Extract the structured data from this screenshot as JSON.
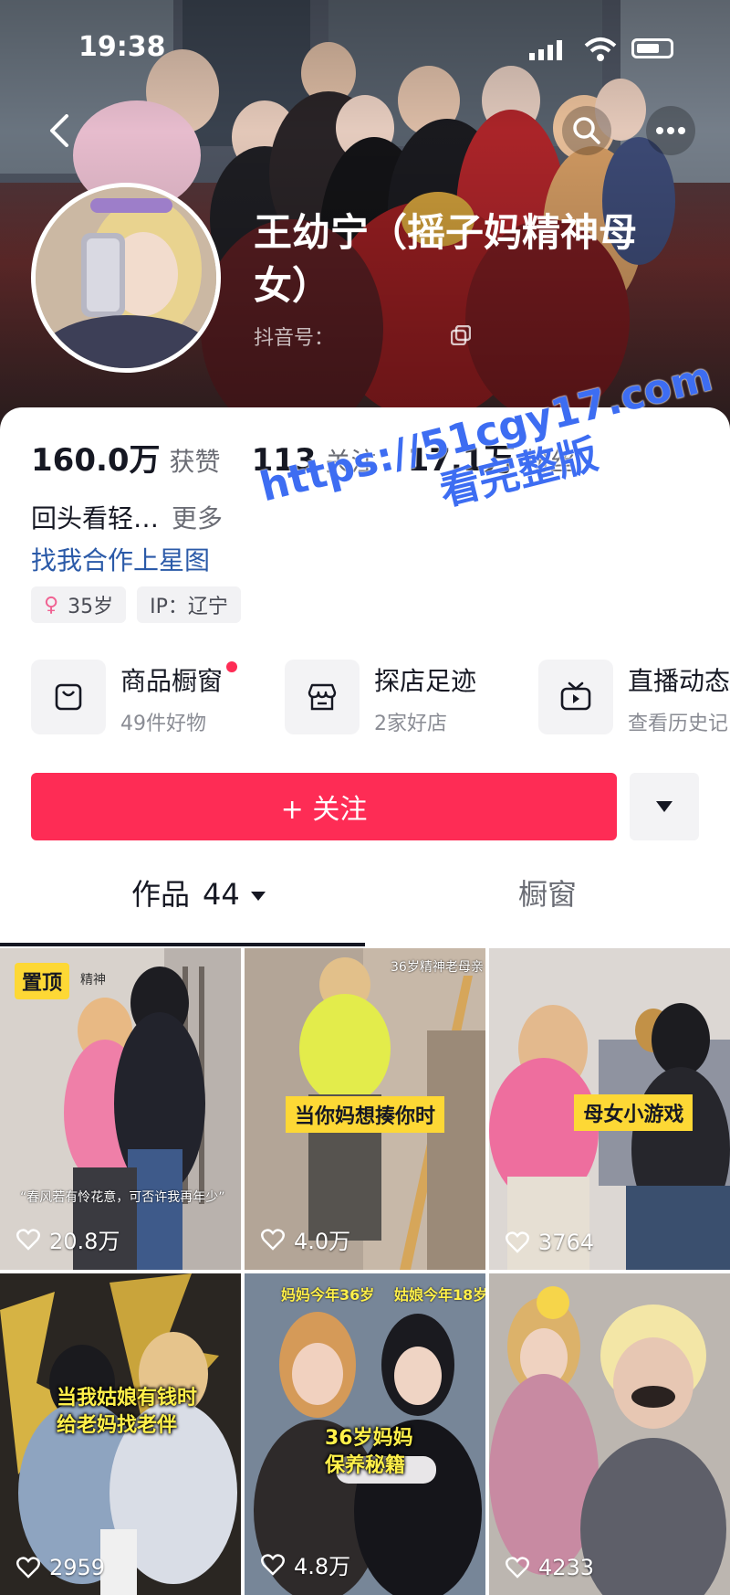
{
  "status_bar": {
    "time": "19:38"
  },
  "profile": {
    "name": "王幼宁（摇子妈精神母女）",
    "douyin_id_label": "抖音号：",
    "stats": [
      {
        "value": "160.0万",
        "label": "获赞"
      },
      {
        "value": "113",
        "label": "关注"
      },
      {
        "value": "17.1万",
        "label": "粉丝"
      }
    ],
    "bio": "回头看轻…",
    "bio_more": "更多",
    "cooperation_link": "找我合作上星图",
    "tags": {
      "age": "35岁",
      "ip": "IP：辽宁"
    }
  },
  "services": [
    {
      "title": "商品橱窗",
      "subtitle": "49件好物",
      "icon": "bag-icon"
    },
    {
      "title": "探店足迹",
      "subtitle": "2家好店",
      "icon": "store-icon"
    },
    {
      "title": "直播动态",
      "subtitle": "查看历史记",
      "icon": "tv-icon"
    }
  ],
  "actions": {
    "follow": "+ 关注"
  },
  "tabs": {
    "works_label": "作品",
    "works_count": "44",
    "shop_label": "橱窗"
  },
  "videos": [
    {
      "likes": "20.8万",
      "pin": "置顶",
      "subtitle": "“春风若有怜花意，可否许我再年少”",
      "tag": "精神"
    },
    {
      "likes": "4.0万",
      "caption": "当你妈想揍你时",
      "top_text": "36岁精神老母亲"
    },
    {
      "likes": "3764",
      "caption": "母女小游戏"
    },
    {
      "likes": "2959",
      "caption_line1": "当我姑娘有钱时",
      "caption_line2": "给老妈找老伴"
    },
    {
      "likes": "4.8万",
      "top_left": "妈妈今年36岁",
      "top_right": "姑娘今年18岁",
      "caption_line1": "36岁妈妈",
      "caption_line2": "保养秘籍"
    },
    {
      "likes": "4233"
    }
  ],
  "watermark": {
    "line1": "https://51cgy17.com",
    "line2": "看完整版"
  },
  "colors": {
    "accent": "#fe2c55",
    "link": "#2b5aa8",
    "caption_yellow": "#fdd835",
    "watermark": "#3d6df2"
  }
}
